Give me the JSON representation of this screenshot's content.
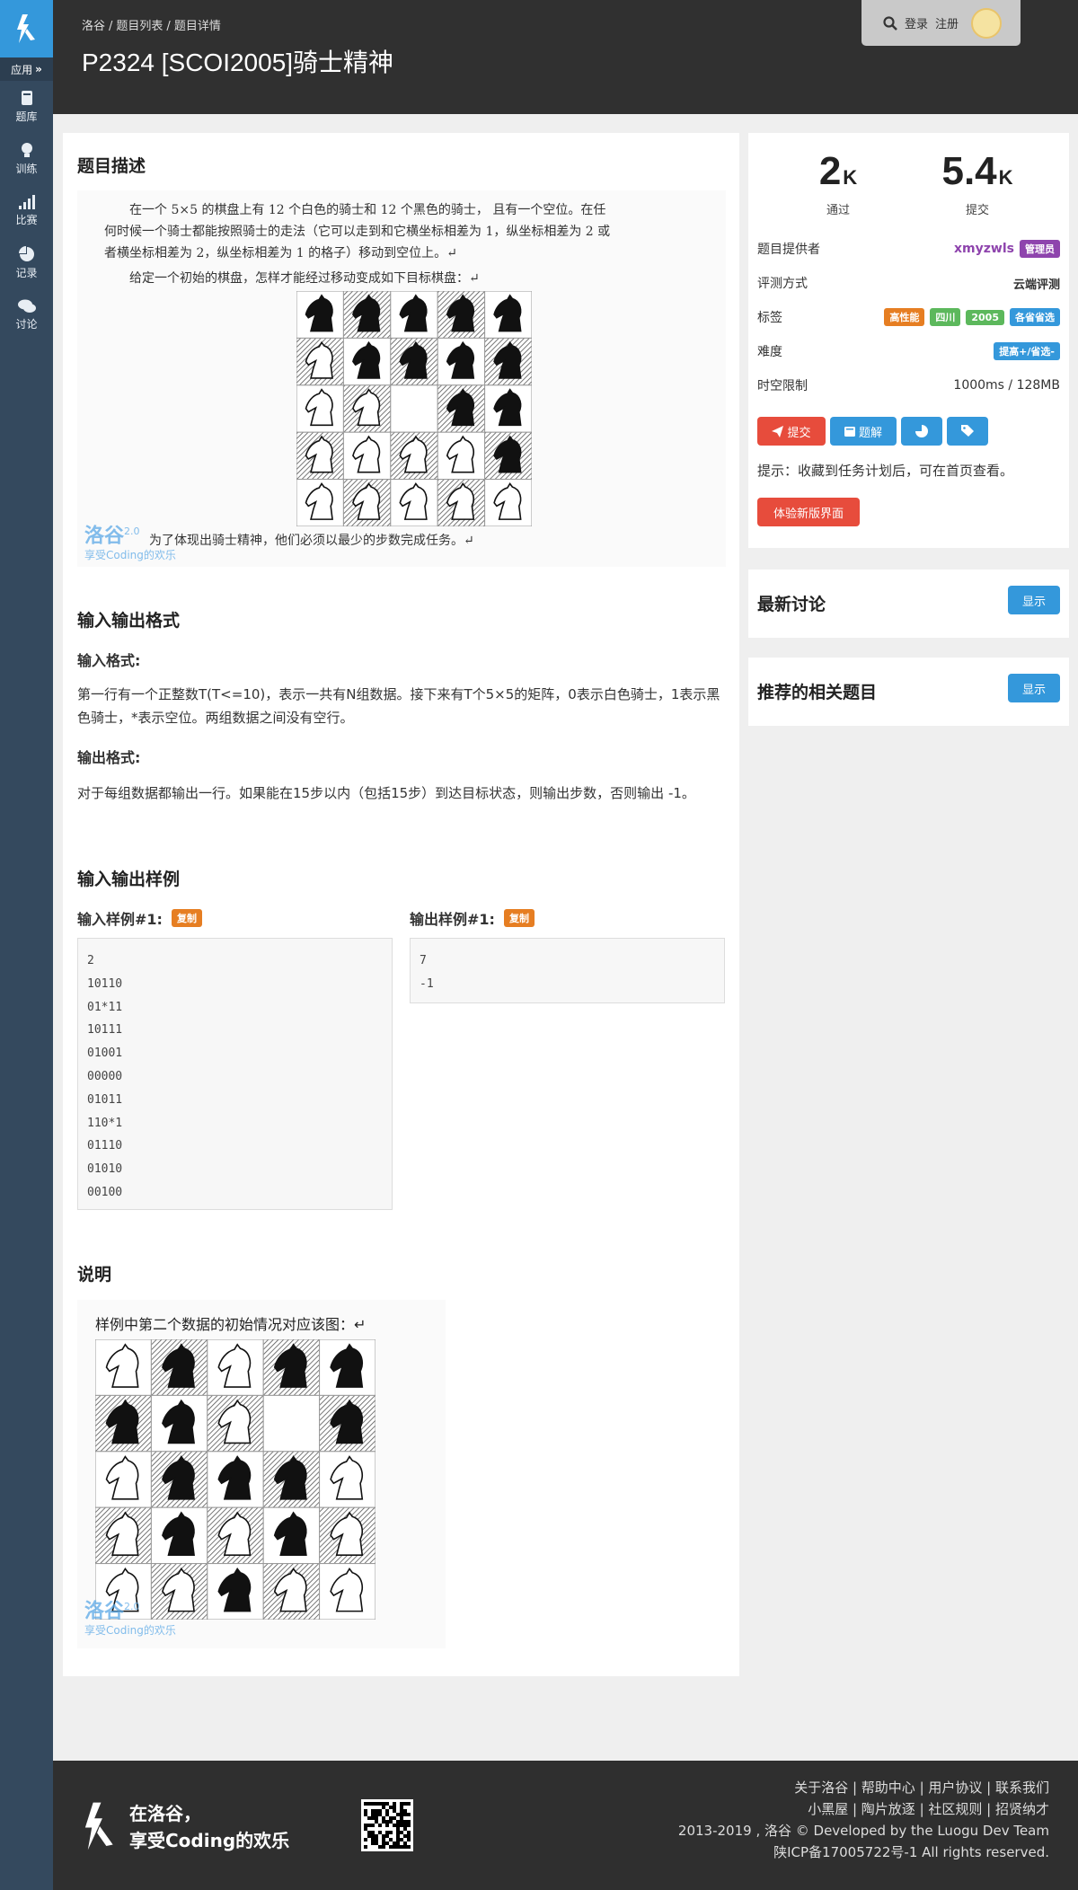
{
  "sidebar": {
    "apps_label": "应用",
    "items": [
      {
        "icon": "book-icon",
        "label": "题库"
      },
      {
        "icon": "lightbulb-icon",
        "label": "训练"
      },
      {
        "icon": "signal-bars-icon",
        "label": "比赛"
      },
      {
        "icon": "pie-chart-icon",
        "label": "记录"
      },
      {
        "icon": "comments-icon",
        "label": "讨论"
      }
    ]
  },
  "header": {
    "breadcrumb": [
      "洛谷",
      "题目列表",
      "题目详情"
    ],
    "title": "P2324 [SCOI2005]骑士精神",
    "login": "登录",
    "register": "注册"
  },
  "problem": {
    "description_title": "题目描述",
    "desc_image_text": [
      "在一个 5×5 的棋盘上有 12 个白色的骑士和 12 个黑色的骑士， 且有一个空位。在任",
      "何时候一个骑士都能按照骑士的走法（它可以走到和它横坐标相差为 1，纵坐标相差为 2 或",
      "者横坐标相差为 2，纵坐标相差为 1 的格子）移动到空位上。↵",
      "给定一个初始的棋盘，怎样才能经过移动变成如下目标棋盘：↵",
      "为了体现出骑士精神，他们必须以最少的步数完成任务。↵"
    ],
    "watermark": {
      "logo": "洛谷",
      "version": "2.0",
      "slogan": "享受Coding的欢乐"
    },
    "io_title": "输入输出格式",
    "input_label": "输入格式:",
    "input_text": "第一行有一个正整数T(T<=10)，表示一共有N组数据。接下来有T个5×5的矩阵，0表示白色骑士，1表示黑色骑士，*表示空位。两组数据之间没有空行。",
    "output_label": "输出格式:",
    "output_text": "对于每组数据都输出一行。如果能在15步以内（包括15步）到达目标状态，则输出步数，否则输出 -1。",
    "samples_title": "输入输出样例",
    "sample_input_label": "输入样例#1:",
    "sample_output_label": "输出样例#1:",
    "copy_label": "复制",
    "sample_input": [
      "2",
      "10110",
      "01*11",
      "10111",
      "01001",
      "00000",
      "01011",
      "110*1",
      "01110",
      "01010",
      "00100"
    ],
    "sample_output": [
      "7",
      "-1"
    ],
    "explain_title": "说明",
    "explain_image_text": "样例中第二个数据的初始情况对应该图：↵"
  },
  "boards": {
    "target": [
      "11111",
      "01111",
      "00*11",
      "00001",
      "00000"
    ],
    "sample2": [
      "01011",
      "110*1",
      "01110",
      "01010",
      "00100"
    ]
  },
  "stats": {
    "passed": "2",
    "passed_unit": "K",
    "passed_label": "通过",
    "submitted": "5.4",
    "submitted_unit": "K",
    "submitted_label": "提交"
  },
  "info": {
    "provider_label": "题目提供者",
    "provider": "xmyzwls",
    "provider_badge": "管理员",
    "judge_label": "评测方式",
    "judge": "云端评测",
    "tags_label": "标签",
    "tags": [
      {
        "text": "高性能",
        "color": "#e67e22"
      },
      {
        "text": "四川",
        "color": "#5cb85c"
      },
      {
        "text": "2005",
        "color": "#5cb85c"
      },
      {
        "text": "各省省选",
        "color": "#3498db"
      }
    ],
    "difficulty_label": "难度",
    "difficulty": "提高+/省选-",
    "difficulty_color": "#3498db",
    "limit_label": "时空限制",
    "limit": "1000ms / 128MB"
  },
  "actions": {
    "submit": "提交",
    "solution": "题解",
    "hint": "提示：收藏到任务计划后，可在首页查看。",
    "new_ui": "体验新版界面"
  },
  "discuss": {
    "title": "最新讨论",
    "button": "显示"
  },
  "related": {
    "title": "推荐的相关题目",
    "button": "显示"
  },
  "footer": {
    "slogan_line1": "在洛谷，",
    "slogan_line2": "享受Coding的欢乐",
    "links_line1": "关于洛谷 | 帮助中心 | 用户协议 | 联系我们",
    "links_line2": "小黑屋 | 陶片放逐 | 社区规则 | 招贤纳才",
    "links_line3": "2013-2019 , 洛谷 © Developed by the Luogu Dev Team",
    "links_line4": "陕ICP备17005722号-1 All rights reserved."
  },
  "colors": {
    "sidebar": "#34495e",
    "accent": "#3498db",
    "danger": "#e74c3c",
    "header": "#303030",
    "admin_purple": "#8e44ad"
  }
}
